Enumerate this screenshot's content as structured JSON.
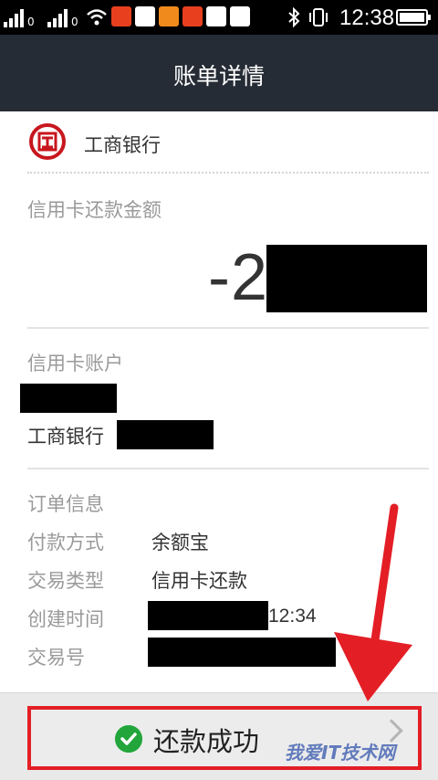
{
  "status_bar": {
    "time": "12:38"
  },
  "header": {
    "title": "账单详情"
  },
  "bank": {
    "name": "工商银行"
  },
  "amount": {
    "label": "信用卡还款金额",
    "value_visible": "-2"
  },
  "account": {
    "label": "信用卡账户",
    "bank_name": "工商银行"
  },
  "order": {
    "section_label": "订单信息",
    "rows": [
      {
        "key": "付款方式",
        "value": "余额宝"
      },
      {
        "key": "交易类型",
        "value": "信用卡还款"
      },
      {
        "key": "创建时间",
        "value": ""
      },
      {
        "key": "交易号",
        "value": ""
      }
    ],
    "created_time_suffix": "12:34"
  },
  "footer": {
    "status_label": "还款成功"
  },
  "watermark": "我爱IT技术网",
  "colors": {
    "header_bg": "#262c35",
    "accent_red": "#e41e25",
    "success_green": "#22a63b",
    "icbc_red": "#c8161e"
  },
  "icons": {
    "success": "check-circle-icon",
    "chevron": "chevron-right-icon",
    "bank_logo": "icbc-logo"
  }
}
